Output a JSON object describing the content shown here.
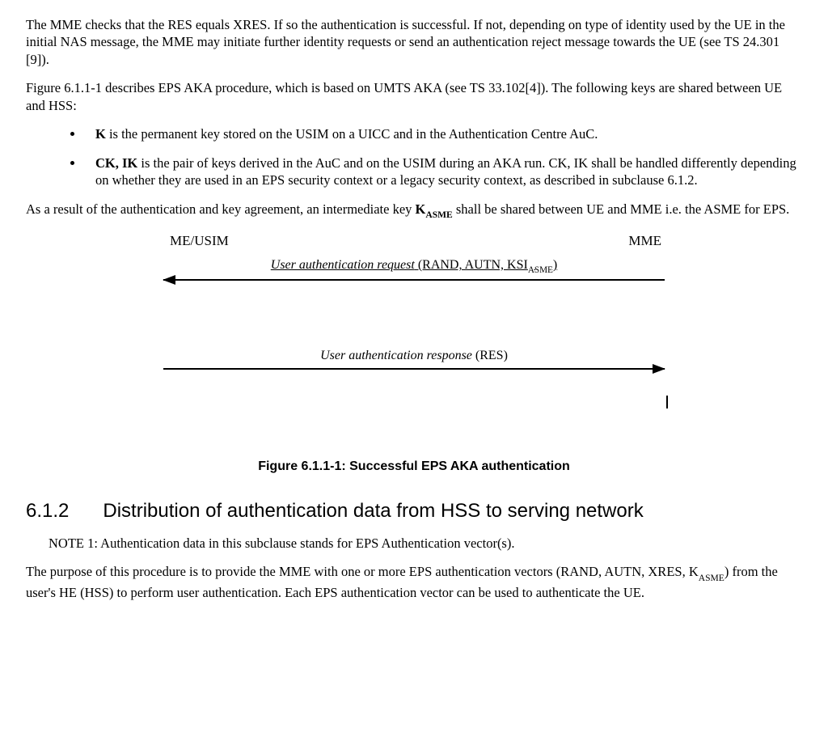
{
  "para1": {
    "t": "The MME checks that the RES equals XRES. If so the authentication is successful. If not, depending on type of identity used by the UE in the initial NAS message, the MME may initiate further identity requests or send an authentication reject message towards the UE (see TS 24.301 [9])."
  },
  "para2": {
    "t": "Figure 6.1.1-1 describes EPS AKA procedure, which is based on UMTS AKA (see TS 33.102[4]). The following keys are shared between UE and HSS:"
  },
  "bullet1": {
    "lead_b": "K",
    "rest": " is the permanent key stored on the USIM on a UICC and in the Authentication Centre AuC."
  },
  "bullet2": {
    "lead_b": "CK, IK",
    "rest": " is the pair of keys derived in the AuC and on the USIM during an AKA run. CK, IK shall be handled differently depending on whether they are used in an EPS security context or a legacy security context, as described in subclause 6.1.2."
  },
  "para3": {
    "pre": "As a result of the authentication and key agreement, an intermediate key ",
    "k_b": "K",
    "k_sub": "ASME",
    "post": " shall be shared between UE and MME i.e. the ASME for EPS."
  },
  "diagram": {
    "left_label": "ME/USIM",
    "right_label": "MME",
    "arrow1": {
      "ital": "User authentication request",
      "rest_pre": " (RAND, AUTN, KSI",
      "sub": "ASME",
      "rest_post": ")"
    },
    "arrow2": {
      "ital": "User authentication response",
      "rest": " (RES)"
    },
    "caption": "Figure 6.1.1-1: Successful EPS AKA authentication"
  },
  "section": {
    "num": "6.1.2",
    "title": "Distribution of authentication data from HSS to serving network"
  },
  "note1": {
    "t": "NOTE 1: Authentication data in this subclause stands for EPS Authentication vector(s)."
  },
  "para4": {
    "pre": "The purpose of this procedure is to provide the MME with one or more EPS authentication vectors (RAND, AUTN, XRES, K",
    "sub": "ASME",
    "post": ") from the user's HE (HSS) to perform user authentication. Each EPS authentication vector can be used to authenticate the UE."
  }
}
